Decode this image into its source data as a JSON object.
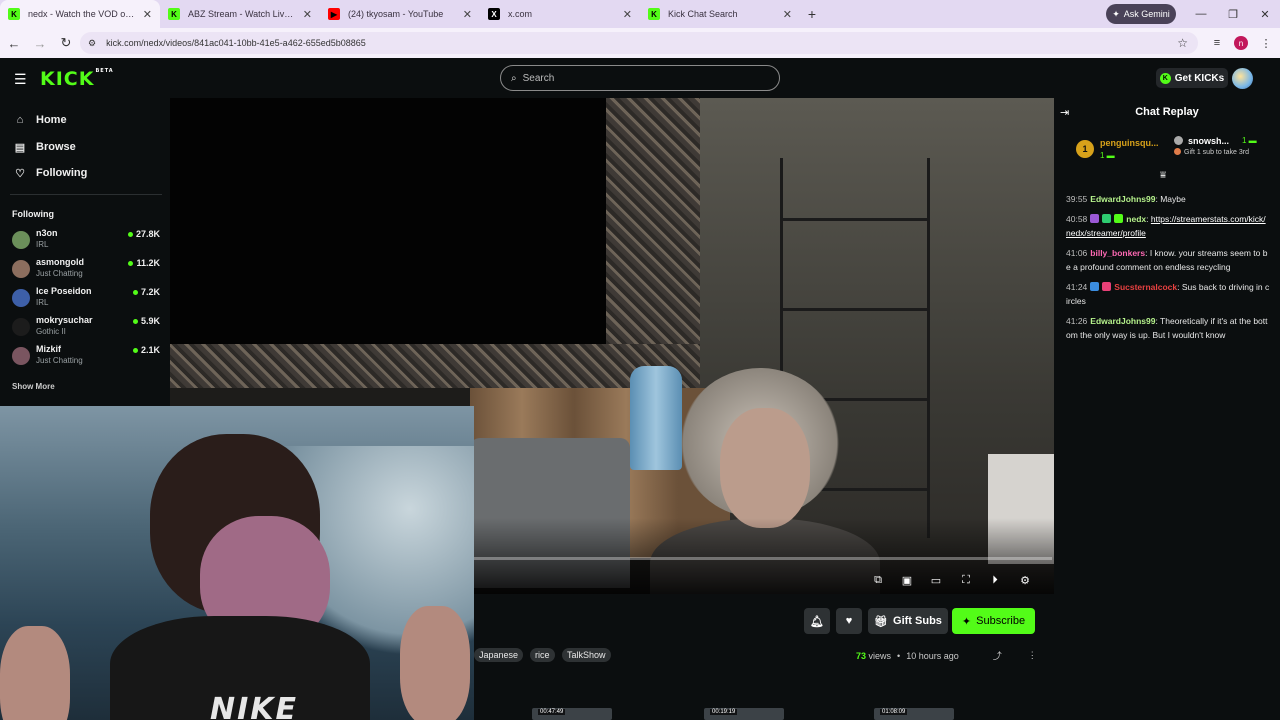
{
  "browser": {
    "tabs": [
      {
        "title": "nedx - Watch the VOD on Kick",
        "fav": "K",
        "fav_color": "#53fc18",
        "active": true
      },
      {
        "title": "ABZ Stream - Watch Live on Kick",
        "fav": "K",
        "fav_color": "#53fc18",
        "active": false
      },
      {
        "title": "(24) tkyosam - YouTube",
        "fav": "▶",
        "fav_color": "#ff0000",
        "active": false
      },
      {
        "title": "x.com",
        "fav": "X",
        "fav_color": "#000000",
        "active": false
      },
      {
        "title": "Kick Chat Search",
        "fav": "K",
        "fav_color": "#53fc18",
        "active": false
      }
    ],
    "new_tab": "+",
    "gemini_label": "Ask Gemini",
    "url": "kick.com/nedx/videos/841ac041-10bb-41e5-a462-655ed5b08865",
    "profile_letter": "n"
  },
  "header": {
    "logo": "KICK",
    "logo_beta": "BETA",
    "search_placeholder": "Search",
    "get_kicks": "Get KICKs"
  },
  "sidebar": {
    "nav": [
      {
        "label": "Home",
        "icon": "home-icon"
      },
      {
        "label": "Browse",
        "icon": "browse-icon"
      },
      {
        "label": "Following",
        "icon": "heart-icon"
      }
    ],
    "following_heading": "Following",
    "following": [
      {
        "name": "n3on",
        "category": "IRL",
        "viewers": "27.8K",
        "avatar_color": "#6b8f5a"
      },
      {
        "name": "asmongold",
        "category": "Just Chatting",
        "viewers": "11.2K",
        "avatar_color": "#8c6e5e"
      },
      {
        "name": "Ice Poseidon",
        "category": "IRL",
        "viewers": "7.2K",
        "avatar_color": "#3d5fa8"
      },
      {
        "name": "mokrysuchar",
        "category": "Gothic II",
        "viewers": "5.9K",
        "avatar_color": "#1c1c1c"
      },
      {
        "name": "Mizkif",
        "category": "Just Chatting",
        "viewers": "2.1K",
        "avatar_color": "#7a5560"
      }
    ],
    "show_more": "Show More"
  },
  "video": {
    "progress_fraction": 0.0
  },
  "webcam": {
    "shirt_text": "NIKE"
  },
  "actions": {
    "gift_subs": "Gift Subs",
    "subscribe": "Subscribe"
  },
  "tags": [
    "Japanese",
    "rice",
    "TalkShow"
  ],
  "meta": {
    "views_count": "73",
    "views_label": "views",
    "separator": "•",
    "age": "10 hours ago"
  },
  "thumbnails": [
    "00:47:49",
    "00:19:19",
    "01:08:09"
  ],
  "chat": {
    "title": "Chat Replay",
    "pinned": [
      {
        "rank": "1",
        "name": "penguinsqu...",
        "value": "1"
      },
      {
        "name": "snowsh...",
        "value": "1",
        "subtext": "Gift 1 sub to take 3rd"
      }
    ],
    "messages": [
      {
        "time": "39:55",
        "user": "EdwardJohns99",
        "color": "#b6f28c",
        "badges": [],
        "text": "Maybe"
      },
      {
        "time": "40:58",
        "user": "nedx",
        "color": "#b6f28c",
        "badges": [
          "#9b59d6",
          "#2ecc71",
          "#53fc18"
        ],
        "text": "https://streamerstats.com/kick/nedx/streamer/profile",
        "link": true
      },
      {
        "time": "41:06",
        "user": "billy_bonkers",
        "color": "#ff69b4",
        "badges": [],
        "text": "I know. your streams seem to be a profound comment on endless recycling"
      },
      {
        "time": "41:24",
        "user": "Sucsternalcock",
        "color": "#e84141",
        "badges": [
          "#3b8de0",
          "#e84178"
        ],
        "text": "Sus back to driving in circles"
      },
      {
        "time": "41:26",
        "user": "EdwardJohns99",
        "color": "#b6f28c",
        "badges": [],
        "text": "Theoretically if it's at the bottom the only way is up. But I wouldn't know"
      }
    ]
  }
}
